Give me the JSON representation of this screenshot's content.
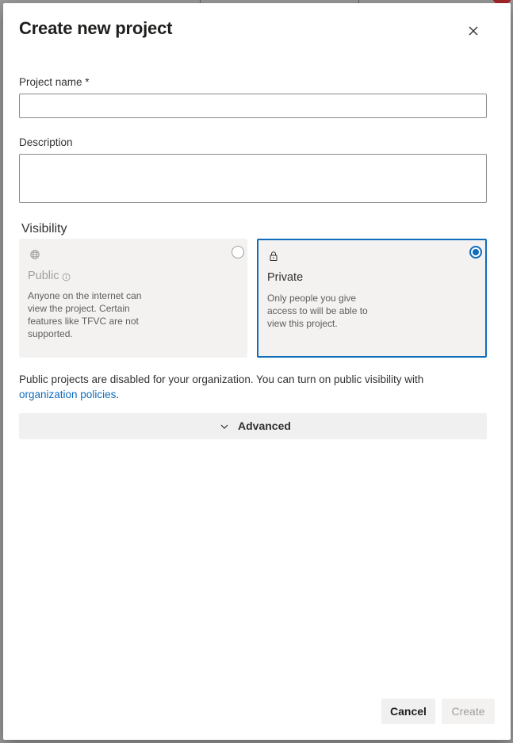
{
  "dialog": {
    "title": "Create new project"
  },
  "form": {
    "project_name_label": "Project name *",
    "project_name_value": "",
    "description_label": "Description",
    "description_value": ""
  },
  "visibility": {
    "label": "Visibility",
    "options": [
      {
        "title": "Public",
        "description": "Anyone on the internet can view the project. Certain features like TFVC are not supported.",
        "icon": "globe-icon",
        "selected": false,
        "disabled": true
      },
      {
        "title": "Private",
        "description": "Only people you give access to will be able to view this project.",
        "icon": "lock-icon",
        "selected": true,
        "disabled": false
      }
    ],
    "notice": "Public projects are disabled for your organization. You can turn on public visibility with",
    "notice_link": "organization policies",
    "notice_end": "."
  },
  "advanced": {
    "label": "Advanced"
  },
  "buttons": {
    "cancel": "Cancel",
    "create": "Create"
  },
  "colors": {
    "accent": "#0f6cbd",
    "disabled_text": "#a19f9d"
  }
}
